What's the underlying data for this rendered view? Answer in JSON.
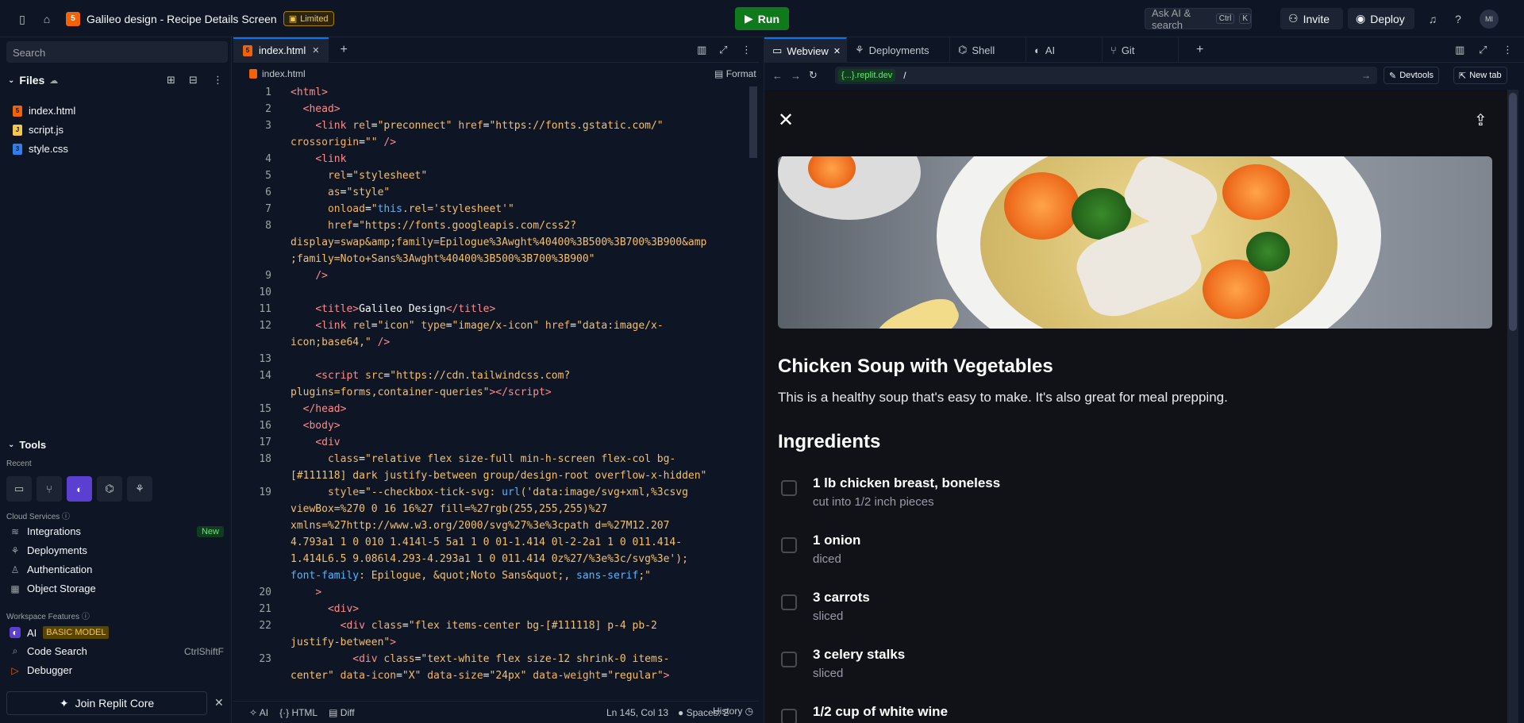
{
  "topbar": {
    "project_name": "Galileo design - Recipe Details Screen",
    "limited": "Limited",
    "run": "Run",
    "ask_ai": "Ask AI & search",
    "kbd_ctrl": "Ctrl",
    "kbd_k": "K",
    "invite": "Invite",
    "deploy": "Deploy",
    "avatar": "MI"
  },
  "sidebar": {
    "search_placeholder": "Search",
    "files_label": "Files",
    "files": [
      "index.html",
      "script.js",
      "style.css"
    ],
    "tools_label": "Tools",
    "recent_label": "Recent",
    "cloud_label": "Cloud Services",
    "cloud_items": [
      "Integrations",
      "Deployments",
      "Authentication",
      "Object Storage"
    ],
    "new_badge": "New",
    "workspace_label": "Workspace Features",
    "ai_label": "AI",
    "basic_model": "BASIC MODEL",
    "code_search": "Code Search",
    "code_search_shortcut": "CtrlShiftF",
    "debugger": "Debugger",
    "join": "Join Replit Core"
  },
  "editor": {
    "tab": "index.html",
    "path": "index.html",
    "format": "Format",
    "status": {
      "ai": "AI",
      "lang": "HTML",
      "diff": "Diff",
      "position": "Ln 145, Col 13",
      "spaces": "Spaces: 2",
      "history": "History"
    }
  },
  "right": {
    "tabs": [
      "Webview",
      "Deployments",
      "Shell",
      "AI",
      "Git"
    ],
    "url_badge": "{...}.replit.dev",
    "url_path": "/",
    "devtools": "Devtools",
    "new_tab": "New tab"
  },
  "recipe": {
    "title": "Chicken Soup with Vegetables",
    "description": "This is a healthy soup that's easy to make. It's also great for meal prepping.",
    "ingredients_heading": "Ingredients",
    "ingredients": [
      {
        "name": "1 lb chicken breast, boneless",
        "note": "cut into 1/2 inch pieces"
      },
      {
        "name": "1 onion",
        "note": "diced"
      },
      {
        "name": "3 carrots",
        "note": "sliced"
      },
      {
        "name": "3 celery stalks",
        "note": "sliced"
      },
      {
        "name": "1/2 cup of white wine",
        "note": ""
      }
    ]
  }
}
